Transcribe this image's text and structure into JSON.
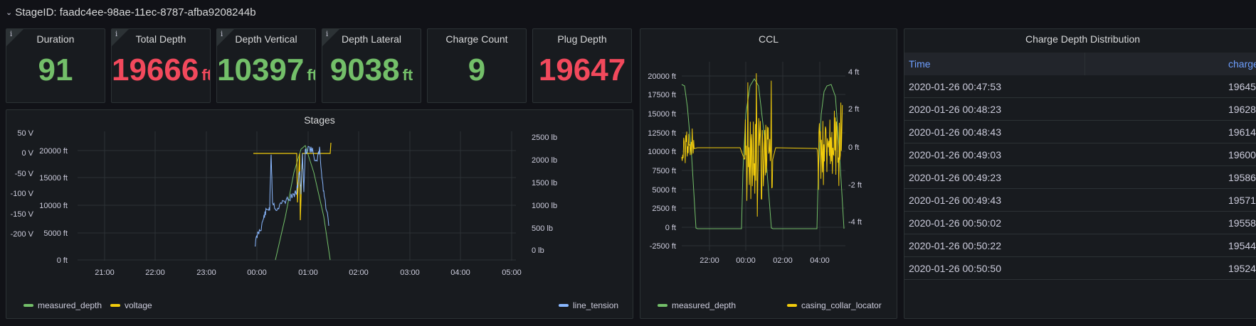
{
  "row": {
    "title": "StageID: faadc4ee-98ae-11ec-8787-afba9208244b"
  },
  "stats": [
    {
      "title": "Duration",
      "value": "91",
      "unit": "",
      "color": "#73bf69",
      "info": true
    },
    {
      "title": "Total Depth",
      "value": "19666",
      "unit": "ft",
      "color": "#f2495c",
      "info": true
    },
    {
      "title": "Depth Vertical",
      "value": "10397",
      "unit": "ft",
      "color": "#73bf69",
      "info": true
    },
    {
      "title": "Depth Lateral",
      "value": "9038",
      "unit": "ft",
      "color": "#73bf69",
      "info": true
    },
    {
      "title": "Charge Count",
      "value": "9",
      "unit": "",
      "color": "#73bf69",
      "info": false
    },
    {
      "title": "Plug Depth",
      "value": "19647",
      "unit": "",
      "color": "#f2495c",
      "info": false
    }
  ],
  "stages": {
    "title": "Stages",
    "left_axis_v": [
      "50 V",
      "0 V",
      "-50 V",
      "-100 V",
      "-150 V",
      "-200 V"
    ],
    "left_axis_ft": [
      "20000 ft",
      "15000 ft",
      "10000 ft",
      "5000 ft",
      "0 ft"
    ],
    "right_axis": [
      "2500 lb",
      "2000 lb",
      "1500 lb",
      "1000 lb",
      "500 lb",
      "0 lb"
    ],
    "x_ticks": [
      "21:00",
      "22:00",
      "23:00",
      "00:00",
      "01:00",
      "02:00",
      "03:00",
      "04:00",
      "05:00"
    ],
    "legend": [
      "measured_depth",
      "voltage",
      "line_tension"
    ]
  },
  "ccl": {
    "title": "CCL",
    "left_axis": [
      "20000 ft",
      "17500 ft",
      "15000 ft",
      "12500 ft",
      "10000 ft",
      "7500 ft",
      "5000 ft",
      "2500 ft",
      "0 ft",
      "-2500 ft"
    ],
    "right_axis": [
      "4 ft",
      "2 ft",
      "0 ft",
      "-2 ft",
      "-4 ft"
    ],
    "x_ticks": [
      "22:00",
      "00:00",
      "02:00",
      "04:00"
    ],
    "legend": [
      "measured_depth",
      "casing_collar_locator"
    ]
  },
  "table": {
    "title": "Charge Depth Distribution",
    "columns": [
      "Time",
      "charge"
    ],
    "rows": [
      [
        "2020-01-26 00:47:53",
        "19645"
      ],
      [
        "2020-01-26 00:48:23",
        "19628"
      ],
      [
        "2020-01-26 00:48:43",
        "19614"
      ],
      [
        "2020-01-26 00:49:03",
        "19600"
      ],
      [
        "2020-01-26 00:49:23",
        "19586"
      ],
      [
        "2020-01-26 00:49:43",
        "19571"
      ],
      [
        "2020-01-26 00:50:02",
        "19558"
      ],
      [
        "2020-01-26 00:50:22",
        "19544"
      ],
      [
        "2020-01-26 00:50:50",
        "19524"
      ]
    ]
  },
  "colors": {
    "measured_depth": "#73bf69",
    "voltage": "#f2cc0c",
    "line_tension": "#8ab8ff",
    "casing_collar_locator": "#f2cc0c"
  }
}
